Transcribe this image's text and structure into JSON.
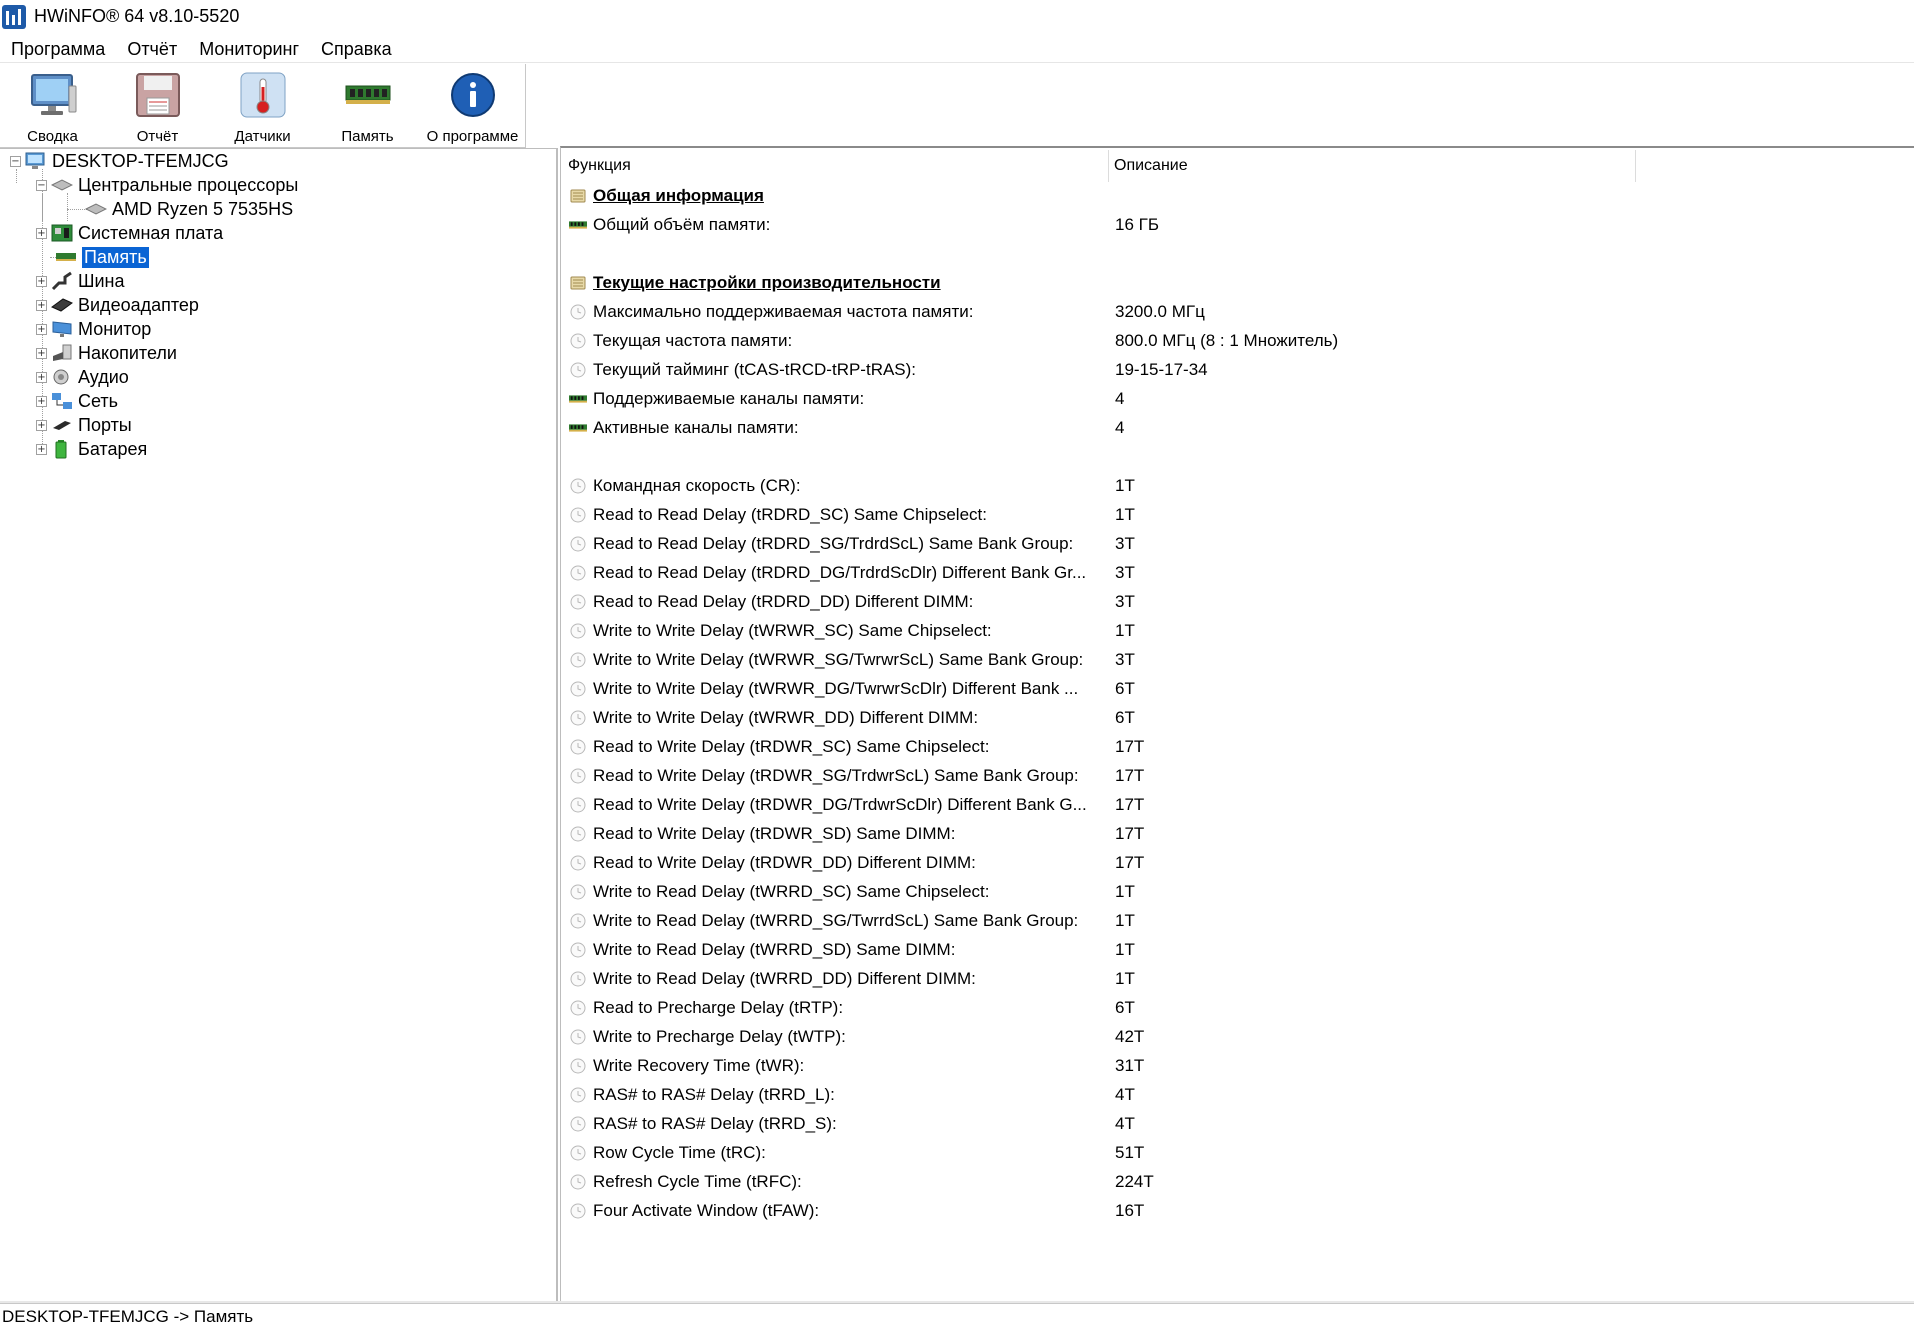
{
  "window": {
    "title": "HWiNFO® 64 v8.10-5520"
  },
  "menu": [
    "Программа",
    "Отчёт",
    "Мониторинг",
    "Справка"
  ],
  "toolbar": [
    {
      "label": "Сводка",
      "icon": "monitor-icon"
    },
    {
      "label": "Отчёт",
      "icon": "floppy-icon"
    },
    {
      "label": "Датчики",
      "icon": "thermometer-icon"
    },
    {
      "label": "Память",
      "icon": "ram-icon"
    },
    {
      "label": "О программе",
      "icon": "info-icon"
    }
  ],
  "tree": {
    "root": "DESKTOP-TFEMJCG",
    "cpu_group": "Центральные процессоры",
    "cpu": "AMD Ryzen 5 7535HS",
    "items": [
      "Системная плата",
      "Память",
      "Шина",
      "Видеоадаптер",
      "Монитор",
      "Накопители",
      "Аудио",
      "Сеть",
      "Порты",
      "Батарея"
    ],
    "selected": "Память"
  },
  "table": {
    "col_function": "Функция",
    "col_description": "Описание",
    "rows": [
      {
        "type": "section",
        "icon": "list-icon",
        "func": "Общая информация",
        "desc": ""
      },
      {
        "type": "row",
        "icon": "ram-icon",
        "func": "Общий объём памяти:",
        "desc": "16 ГБ"
      },
      {
        "type": "blank"
      },
      {
        "type": "section",
        "icon": "list-icon",
        "func": "Текущие настройки производительности",
        "desc": ""
      },
      {
        "type": "row",
        "icon": "clock-icon",
        "func": "Максимально поддерживаемая частота памяти:",
        "desc": "3200.0 МГц"
      },
      {
        "type": "row",
        "icon": "clock-icon",
        "func": "Текущая частота памяти:",
        "desc": "800.0 МГц (8 : 1 Множитель)"
      },
      {
        "type": "row",
        "icon": "clock-icon",
        "func": "Текущий тайминг (tCAS-tRCD-tRP-tRAS):",
        "desc": "19-15-17-34"
      },
      {
        "type": "row",
        "icon": "ram-icon",
        "func": "Поддерживаемые каналы памяти:",
        "desc": "4"
      },
      {
        "type": "row",
        "icon": "ram-icon",
        "func": "Активные каналы памяти:",
        "desc": "4"
      },
      {
        "type": "blank"
      },
      {
        "type": "row",
        "icon": "clock-icon",
        "func": "Командная скорость (CR):",
        "desc": "1T"
      },
      {
        "type": "row",
        "icon": "clock-icon",
        "func": "Read to Read Delay (tRDRD_SC) Same Chipselect:",
        "desc": "1T"
      },
      {
        "type": "row",
        "icon": "clock-icon",
        "func": "Read to Read Delay (tRDRD_SG/TrdrdScL) Same Bank Group:",
        "desc": "3T"
      },
      {
        "type": "row",
        "icon": "clock-icon",
        "func": "Read to Read Delay (tRDRD_DG/TrdrdScDlr) Different Bank Gr...",
        "desc": "3T"
      },
      {
        "type": "row",
        "icon": "clock-icon",
        "func": "Read to Read Delay (tRDRD_DD) Different DIMM:",
        "desc": "3T"
      },
      {
        "type": "row",
        "icon": "clock-icon",
        "func": "Write to Write Delay (tWRWR_SC) Same Chipselect:",
        "desc": "1T"
      },
      {
        "type": "row",
        "icon": "clock-icon",
        "func": "Write to Write Delay (tWRWR_SG/TwrwrScL) Same Bank Group:",
        "desc": "3T"
      },
      {
        "type": "row",
        "icon": "clock-icon",
        "func": "Write to Write Delay (tWRWR_DG/TwrwrScDlr) Different Bank ...",
        "desc": "6T"
      },
      {
        "type": "row",
        "icon": "clock-icon",
        "func": "Write to Write Delay (tWRWR_DD) Different DIMM:",
        "desc": "6T"
      },
      {
        "type": "row",
        "icon": "clock-icon",
        "func": "Read to Write Delay (tRDWR_SC) Same Chipselect:",
        "desc": "17T"
      },
      {
        "type": "row",
        "icon": "clock-icon",
        "func": "Read to Write Delay (tRDWR_SG/TrdwrScL) Same Bank Group:",
        "desc": "17T"
      },
      {
        "type": "row",
        "icon": "clock-icon",
        "func": "Read to Write Delay (tRDWR_DG/TrdwrScDlr) Different Bank G...",
        "desc": "17T"
      },
      {
        "type": "row",
        "icon": "clock-icon",
        "func": "Read to Write Delay (tRDWR_SD) Same DIMM:",
        "desc": "17T"
      },
      {
        "type": "row",
        "icon": "clock-icon",
        "func": "Read to Write Delay (tRDWR_DD) Different DIMM:",
        "desc": "17T"
      },
      {
        "type": "row",
        "icon": "clock-icon",
        "func": "Write to Read Delay (tWRRD_SC) Same Chipselect:",
        "desc": "1T"
      },
      {
        "type": "row",
        "icon": "clock-icon",
        "func": "Write to Read Delay (tWRRD_SG/TwrrdScL) Same Bank Group:",
        "desc": "1T"
      },
      {
        "type": "row",
        "icon": "clock-icon",
        "func": "Write to Read Delay (tWRRD_SD) Same DIMM:",
        "desc": "1T"
      },
      {
        "type": "row",
        "icon": "clock-icon",
        "func": "Write to Read Delay (tWRRD_DD) Different DIMM:",
        "desc": "1T"
      },
      {
        "type": "row",
        "icon": "clock-icon",
        "func": "Read to Precharge Delay (tRTP):",
        "desc": "6T"
      },
      {
        "type": "row",
        "icon": "clock-icon",
        "func": "Write to Precharge Delay (tWTP):",
        "desc": "42T"
      },
      {
        "type": "row",
        "icon": "clock-icon",
        "func": "Write Recovery Time (tWR):",
        "desc": "31T"
      },
      {
        "type": "row",
        "icon": "clock-icon",
        "func": "RAS# to RAS# Delay (tRRD_L):",
        "desc": "4T"
      },
      {
        "type": "row",
        "icon": "clock-icon",
        "func": "RAS# to RAS# Delay (tRRD_S):",
        "desc": "4T"
      },
      {
        "type": "row",
        "icon": "clock-icon",
        "func": "Row Cycle Time (tRC):",
        "desc": "51T"
      },
      {
        "type": "row",
        "icon": "clock-icon",
        "func": "Refresh Cycle Time (tRFC):",
        "desc": "224T"
      },
      {
        "type": "row",
        "icon": "clock-icon",
        "func": "Four Activate Window (tFAW):",
        "desc": "16T"
      }
    ]
  },
  "status": {
    "text": "DESKTOP-TFEMJCG -> Память"
  }
}
